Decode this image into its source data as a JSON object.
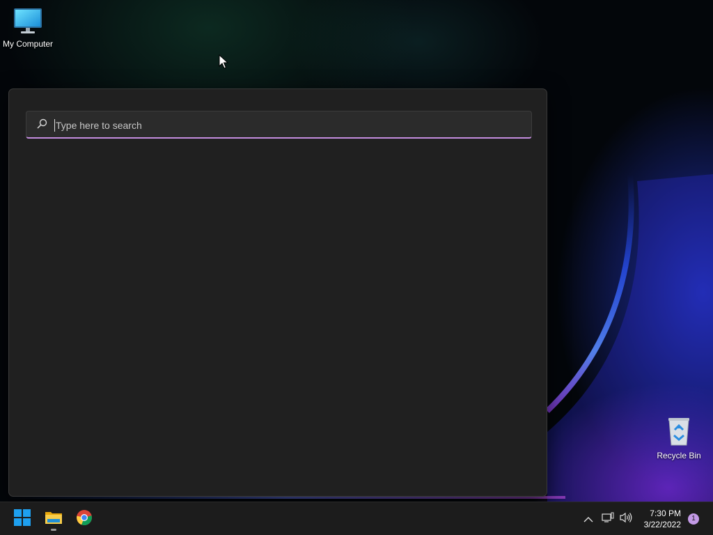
{
  "desktop": {
    "icons": [
      {
        "label": "My Computer",
        "icon": "monitor-icon"
      },
      {
        "label": "Recycle Bin",
        "icon": "recycle-bin-icon"
      }
    ]
  },
  "search": {
    "placeholder": "Type here to search",
    "value": "",
    "accent_color": "#c58de0"
  },
  "taskbar": {
    "apps": [
      {
        "name": "Start",
        "icon": "windows-logo-icon"
      },
      {
        "name": "File Explorer",
        "icon": "folder-icon",
        "running": true
      },
      {
        "name": "Google Chrome",
        "icon": "chrome-icon"
      }
    ],
    "tray": {
      "icons": [
        "chevron-up-icon",
        "network-icon",
        "volume-icon"
      ],
      "time": "7:30 PM",
      "date": "3/22/2022",
      "notification_count": "1"
    }
  },
  "colors": {
    "panel_bg": "#202020",
    "taskbar_bg": "#1c1c1c",
    "windows_blue": "#1ea0f0"
  }
}
